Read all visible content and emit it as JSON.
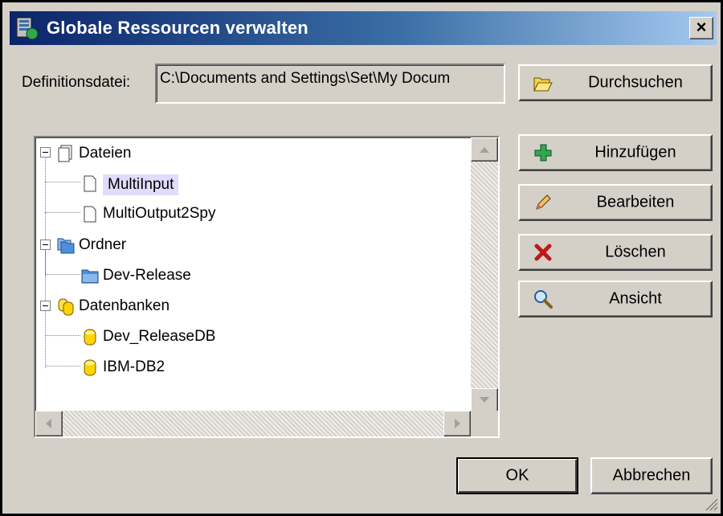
{
  "window": {
    "title": "Globale Ressourcen verwalten",
    "close_label": "×"
  },
  "definition": {
    "label": "Definitionsdatei:",
    "value": "C:\\Documents and Settings\\Set\\My Docum"
  },
  "buttons": {
    "browse": "Durchsuchen",
    "add": "Hinzufügen",
    "edit": "Bearbeiten",
    "delete": "Löschen",
    "view": "Ansicht",
    "ok": "OK",
    "cancel": "Abbrechen"
  },
  "tree": {
    "files": {
      "label": "Dateien",
      "items": [
        "MultiInput",
        "MultiOutput2Spy"
      ],
      "selected": "MultiInput"
    },
    "folders": {
      "label": "Ordner",
      "items": [
        "Dev-Release"
      ]
    },
    "databases": {
      "label": "Datenbanken",
      "items": [
        "Dev_ReleaseDB",
        "IBM-DB2"
      ]
    }
  },
  "colors": {
    "title_gradient_start": "#0b246a",
    "title_gradient_end": "#a6caf0",
    "dialog_bg": "#d4d0c8",
    "selection_bg": "#e0dcfb",
    "folder_blue": "#4f8fd9",
    "db_yellow": "#ffd400"
  },
  "icons": {
    "app": "resources-app-icon",
    "file": "file-icon",
    "folder": "folder-icon",
    "database": "database-icon",
    "browse": "open-folder-icon",
    "add": "plus-icon",
    "edit": "pencil-icon",
    "delete": "red-x-icon",
    "view": "magnifier-icon"
  }
}
